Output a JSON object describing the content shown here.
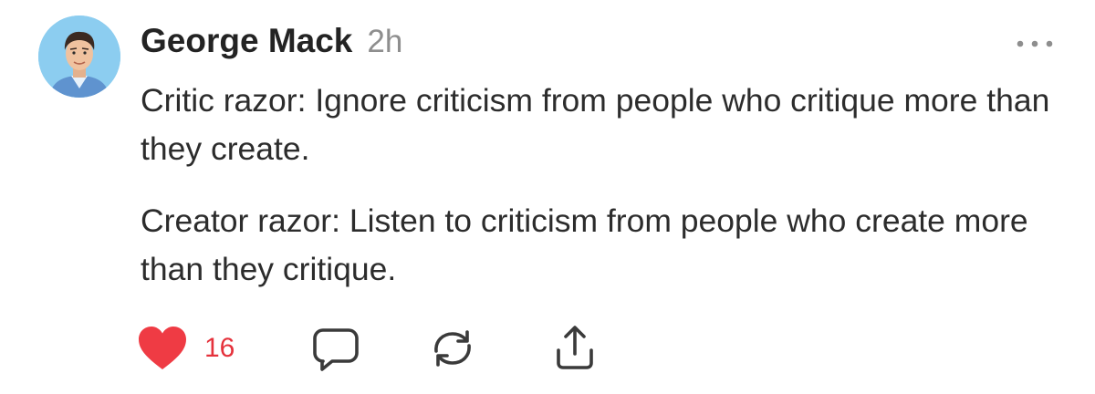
{
  "post": {
    "author": "George Mack",
    "time": "2h",
    "paragraphs": [
      "Critic razor: Ignore criticism from people who critique more than they create.",
      "Creator razor: Listen to criticism from people who create more than they critique."
    ],
    "likes": "16",
    "liked": true
  },
  "icons": {
    "avatar": "avatar-illustration",
    "more": "more-horizontal-icon",
    "like": "heart-icon",
    "reply": "comment-icon",
    "repost": "repost-icon",
    "share": "share-icon"
  },
  "colors": {
    "like": "#e5323c",
    "icon": "#3a3a3a",
    "muted": "#8e8e8e",
    "avatar_bg": "#8ccdf0"
  }
}
